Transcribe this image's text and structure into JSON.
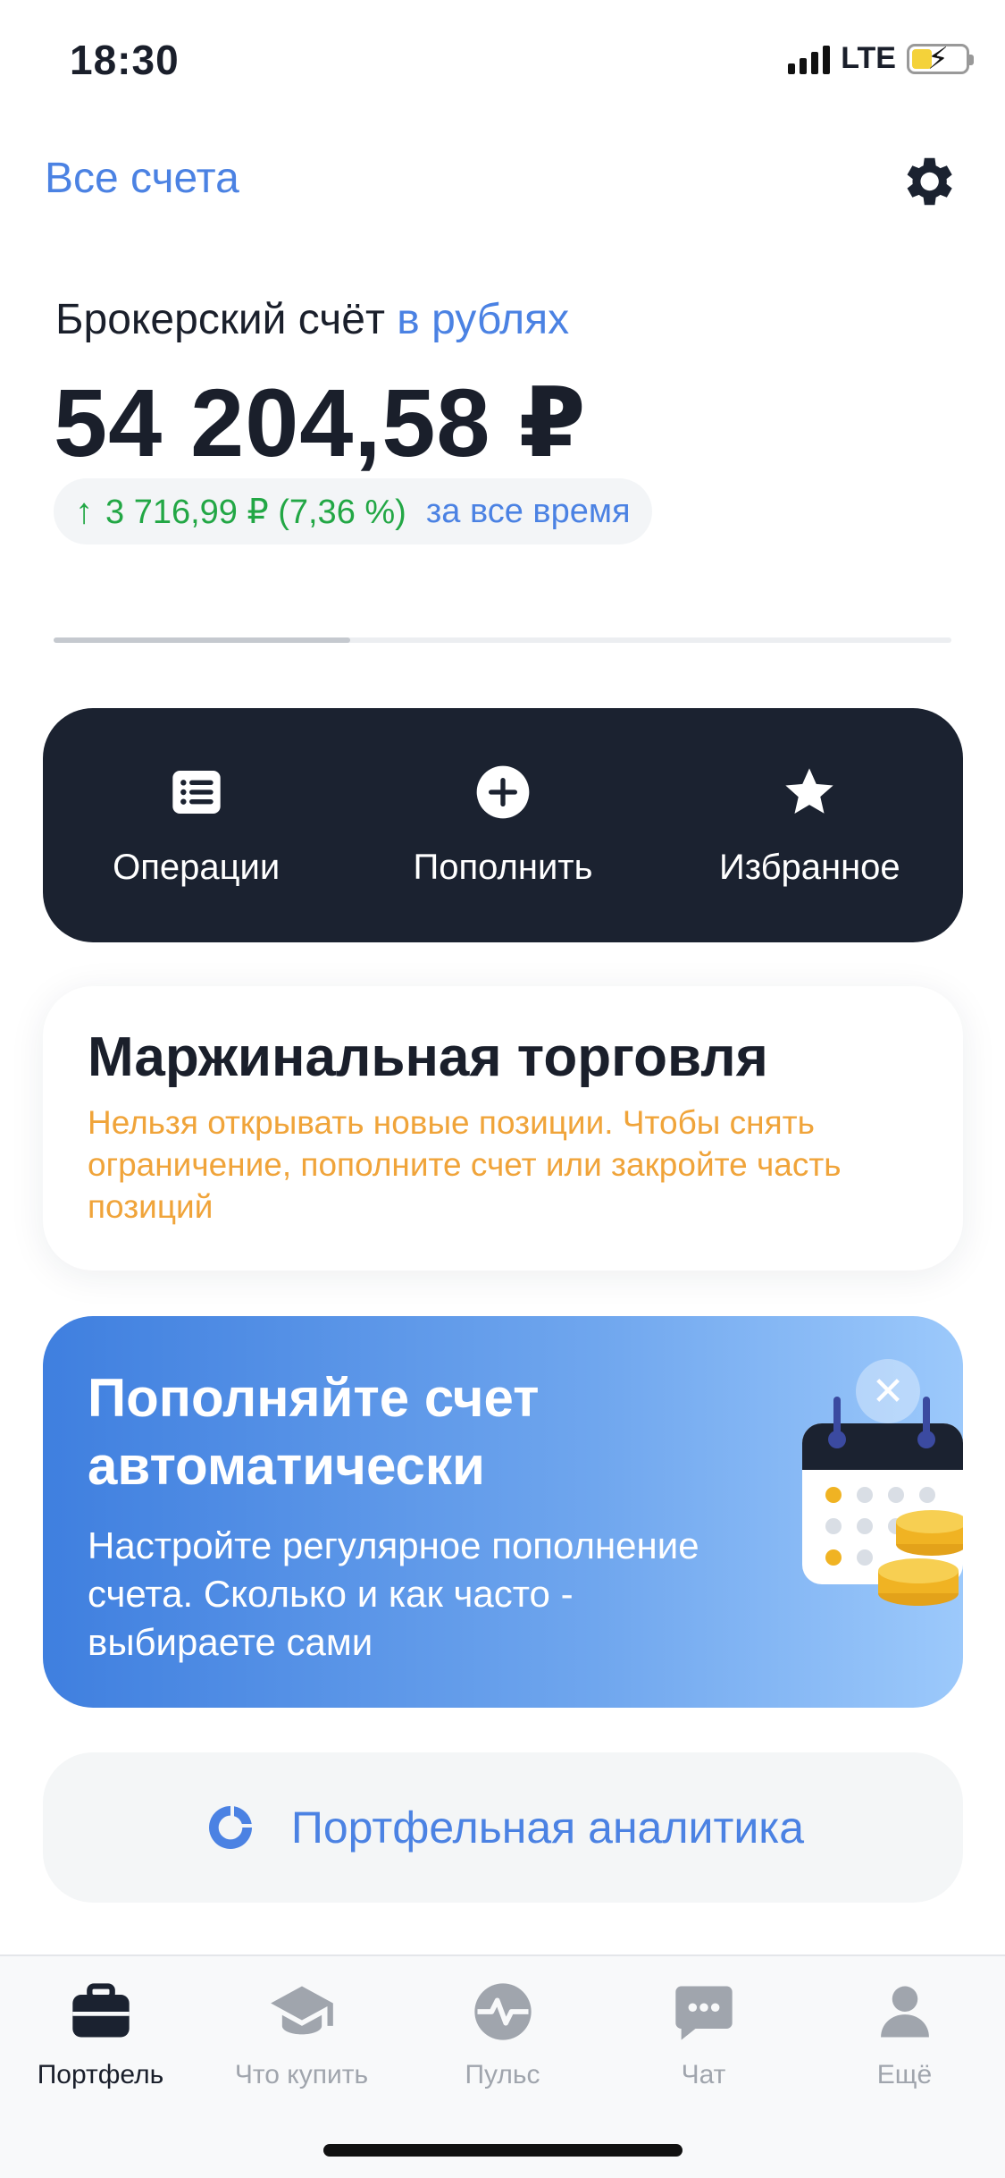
{
  "status_bar": {
    "time": "18:30",
    "network": "LTE"
  },
  "header": {
    "all_accounts": "Все счета"
  },
  "account": {
    "title": "Брокерский счёт",
    "currency": "в рублях",
    "balance": "54 204,58 ₽",
    "profit": "3 716,99 ₽ (7,36 %)",
    "profit_period": "за все время",
    "carousel_position": 0.33
  },
  "actions": [
    {
      "label": "Операции",
      "icon": "list-icon"
    },
    {
      "label": "Пополнить",
      "icon": "plus-circle-icon"
    },
    {
      "label": "Избранное",
      "icon": "star-icon"
    }
  ],
  "margin": {
    "title": "Маржинальная торговля",
    "text": "Нельзя открывать новые позиции. Чтобы снять ограничение, пополните счет или закройте часть позиций"
  },
  "promo": {
    "title": "Пополняйте счет автоматически",
    "text": "Настройте регулярное пополнение счета. Сколько и как часто - выбираете сами"
  },
  "analytics": {
    "label": "Портфельная аналитика"
  },
  "tabs": [
    {
      "label": "Портфель",
      "icon": "briefcase-icon",
      "active": true
    },
    {
      "label": "Что купить",
      "icon": "graduation-cap-icon",
      "active": false
    },
    {
      "label": "Пульс",
      "icon": "pulse-icon",
      "active": false
    },
    {
      "label": "Чат",
      "icon": "chat-icon",
      "active": false
    },
    {
      "label": "Ещё",
      "icon": "profile-icon",
      "active": false
    }
  ],
  "colors": {
    "accent": "#4b82e3",
    "positive": "#22a745",
    "warning": "#f0a43a",
    "panel_dark": "#1b2230"
  }
}
